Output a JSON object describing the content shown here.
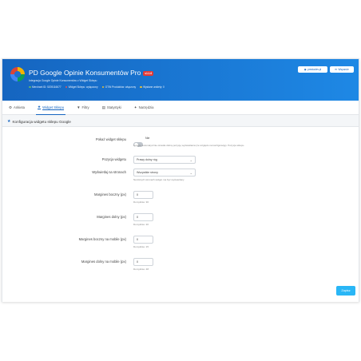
{
  "header": {
    "title": "PD Google Opinie Konsumentów Pro",
    "badge": "v1.1.6",
    "subtitle": "Integracja Google Opinie Konsumentów z Widget Sklepu",
    "status": [
      {
        "label": "Merchant ID: 5205116677",
        "color": "#66bb6a"
      },
      {
        "label": "Widget Sklepu: wyłączony",
        "color": "#ef5350"
      },
      {
        "label": "GTIN Produktów: włączony",
        "color": "#ffca28"
      },
      {
        "label": "Wysłane ankiety: 0",
        "color": "#ffca28"
      }
    ],
    "buttons": [
      {
        "label": "prestadev.pl",
        "icon": "globe-icon"
      },
      {
        "label": "Wsparcie",
        "icon": "envelope-icon"
      }
    ]
  },
  "tabs": [
    {
      "label": "Ankieta",
      "icon": "gears-icon",
      "active": false
    },
    {
      "label": "Widget Sklepu",
      "icon": "star-icon",
      "active": true
    },
    {
      "label": "Filtry",
      "icon": "filter-icon",
      "active": false
    },
    {
      "label": "Statystyki",
      "icon": "bar-chart-icon",
      "active": false
    },
    {
      "label": "Narzędzia",
      "icon": "wrench-icon",
      "active": false
    }
  ],
  "section": {
    "title": "Konfiguracja widgetu sklepu Google"
  },
  "form": {
    "show_widget": {
      "label": "Pokaż widget sklepu",
      "value": "Nie",
      "hint": "Google automatycznie określa dobrą pozycję wyświetlania (ze względu na konfigurację). Pozycja sklepu."
    },
    "position": {
      "label": "Pozycja widgetu",
      "value": "Prawy dolny róg"
    },
    "pages": {
      "label": "Wyświetlaj na stronach",
      "value": "Wszystkie strony",
      "hint": "Na których stronach widget ma być wyświetlany"
    },
    "margin_side": {
      "label": "Margines boczny (px)",
      "value": "0",
      "hint": "Domyślnie: 30"
    },
    "margin_bottom": {
      "label": "Margines dolny (px)",
      "value": "0",
      "hint": "Domyślnie: 20"
    },
    "margin_side_mobile": {
      "label": "Margines boczny na mobile (px)",
      "value": "0",
      "hint": "Domyślnie: 15"
    },
    "margin_bottom_mobile": {
      "label": "Margines dolny na mobile (px)",
      "value": "0",
      "hint": "Domyślnie: 48"
    }
  },
  "save_label": "Zapisz"
}
